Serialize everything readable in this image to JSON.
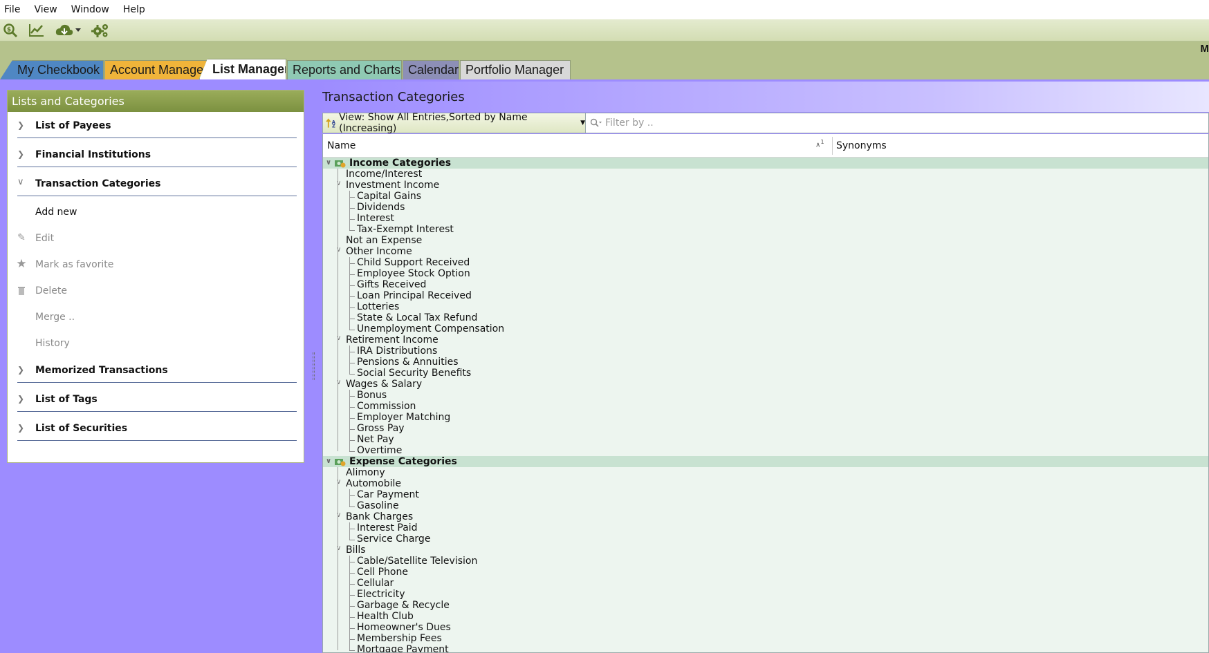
{
  "menu": [
    "File",
    "View",
    "Window",
    "Help"
  ],
  "toolbar": {
    "icons": [
      "search-zoom-icon",
      "line-chart-icon",
      "cloud-download-icon",
      "settings-gears-icon"
    ]
  },
  "tabs": [
    "My Checkbook",
    "Account Manager",
    "List Manager",
    "Reports and Charts",
    "Calendar",
    "Portfolio Manager"
  ],
  "corner_text": "M",
  "left": {
    "title": "Lists and Categories",
    "sections": {
      "payees": "List of Payees",
      "institutions": "Financial Institutions",
      "categories": "Transaction Categories",
      "memorized": "Memorized Transactions",
      "tags": "List of Tags",
      "securities": "List of Securities"
    },
    "actions": {
      "add_new": "Add new",
      "edit": "Edit",
      "favorite": "Mark as favorite",
      "delete": "Delete",
      "merge": "Merge ..",
      "history": "History"
    }
  },
  "right": {
    "title": "Transaction Categories",
    "view_label": "View: Show All Entries,Sorted by Name (Increasing)",
    "filter_placeholder": "Filter by ..",
    "col_name": "Name",
    "col_sort": "1",
    "col_synonyms": "Synonyms",
    "rows": [
      {
        "level": 0,
        "label": "Income Categories"
      },
      {
        "level": 1,
        "label": "Income/Interest"
      },
      {
        "level": 1,
        "label": "Investment Income",
        "expanded": true
      },
      {
        "level": 2,
        "label": "Capital Gains"
      },
      {
        "level": 2,
        "label": "Dividends"
      },
      {
        "level": 2,
        "label": "Interest"
      },
      {
        "level": 2,
        "label": "Tax-Exempt Interest"
      },
      {
        "level": 1,
        "label": "Not an Expense"
      },
      {
        "level": 1,
        "label": "Other Income",
        "expanded": true
      },
      {
        "level": 2,
        "label": "Child Support Received"
      },
      {
        "level": 2,
        "label": "Employee Stock Option"
      },
      {
        "level": 2,
        "label": "Gifts Received"
      },
      {
        "level": 2,
        "label": "Loan Principal Received"
      },
      {
        "level": 2,
        "label": "Lotteries"
      },
      {
        "level": 2,
        "label": "State & Local Tax Refund"
      },
      {
        "level": 2,
        "label": "Unemployment Compensation"
      },
      {
        "level": 1,
        "label": "Retirement Income",
        "expanded": true
      },
      {
        "level": 2,
        "label": "IRA Distributions"
      },
      {
        "level": 2,
        "label": "Pensions & Annuities"
      },
      {
        "level": 2,
        "label": "Social Security Benefits"
      },
      {
        "level": 1,
        "label": "Wages & Salary",
        "expanded": true
      },
      {
        "level": 2,
        "label": "Bonus"
      },
      {
        "level": 2,
        "label": "Commission"
      },
      {
        "level": 2,
        "label": "Employer Matching"
      },
      {
        "level": 2,
        "label": "Gross Pay"
      },
      {
        "level": 2,
        "label": "Net Pay"
      },
      {
        "level": 2,
        "label": "Overtime"
      },
      {
        "level": 0,
        "label": "Expense Categories"
      },
      {
        "level": 1,
        "label": "Alimony"
      },
      {
        "level": 1,
        "label": "Automobile",
        "expanded": true
      },
      {
        "level": 2,
        "label": "Car Payment"
      },
      {
        "level": 2,
        "label": "Gasoline"
      },
      {
        "level": 1,
        "label": "Bank Charges",
        "expanded": true
      },
      {
        "level": 2,
        "label": "Interest Paid"
      },
      {
        "level": 2,
        "label": "Service Charge"
      },
      {
        "level": 1,
        "label": "Bills",
        "expanded": true
      },
      {
        "level": 2,
        "label": "Cable/Satellite Television"
      },
      {
        "level": 2,
        "label": "Cell Phone"
      },
      {
        "level": 2,
        "label": "Cellular"
      },
      {
        "level": 2,
        "label": "Electricity"
      },
      {
        "level": 2,
        "label": "Garbage & Recycle"
      },
      {
        "level": 2,
        "label": "Health Club"
      },
      {
        "level": 2,
        "label": "Homeowner's Dues"
      },
      {
        "level": 2,
        "label": "Membership Fees"
      },
      {
        "level": 2,
        "label": "Mortgage Payment"
      }
    ]
  }
}
